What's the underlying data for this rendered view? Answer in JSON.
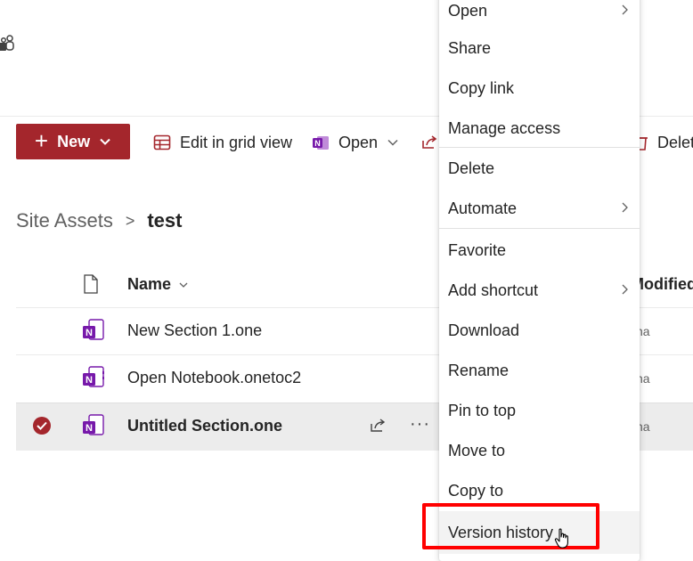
{
  "command_bar": {
    "new_label": "New",
    "edit_grid_label": "Edit in grid view",
    "open_label": "Open",
    "delete_label": "Delet"
  },
  "breadcrumb": {
    "parent": "Site Assets",
    "separator": ">",
    "current": "test"
  },
  "list": {
    "columns": {
      "name": "Name",
      "modified": "Modified"
    },
    "rows": [
      {
        "name": "New Section 1.one",
        "modified": "na",
        "selected": false
      },
      {
        "name": "Open Notebook.onetoc2",
        "modified": "na",
        "selected": false
      },
      {
        "name": "Untitled Section.one",
        "modified": "na",
        "selected": true
      }
    ]
  },
  "context_menu": {
    "items": [
      {
        "label": "Open",
        "submenu": true
      },
      {
        "label": "Share",
        "submenu": false
      },
      {
        "label": "Copy link",
        "submenu": false
      },
      {
        "label": "Manage access",
        "submenu": false
      },
      {
        "label": "Delete",
        "submenu": false
      },
      {
        "label": "Automate",
        "submenu": true
      },
      {
        "label": "Favorite",
        "submenu": false
      },
      {
        "label": "Add shortcut",
        "submenu": true
      },
      {
        "label": "Download",
        "submenu": false
      },
      {
        "label": "Rename",
        "submenu": false
      },
      {
        "label": "Pin to top",
        "submenu": false
      },
      {
        "label": "Move to",
        "submenu": false
      },
      {
        "label": "Copy to",
        "submenu": false
      },
      {
        "label": "Version history",
        "submenu": false,
        "hovered": true
      }
    ]
  },
  "colors": {
    "brand": "#a4262c",
    "onenote": "#7719aa",
    "highlight": "#ff0000",
    "selected_row": "#ececec"
  }
}
